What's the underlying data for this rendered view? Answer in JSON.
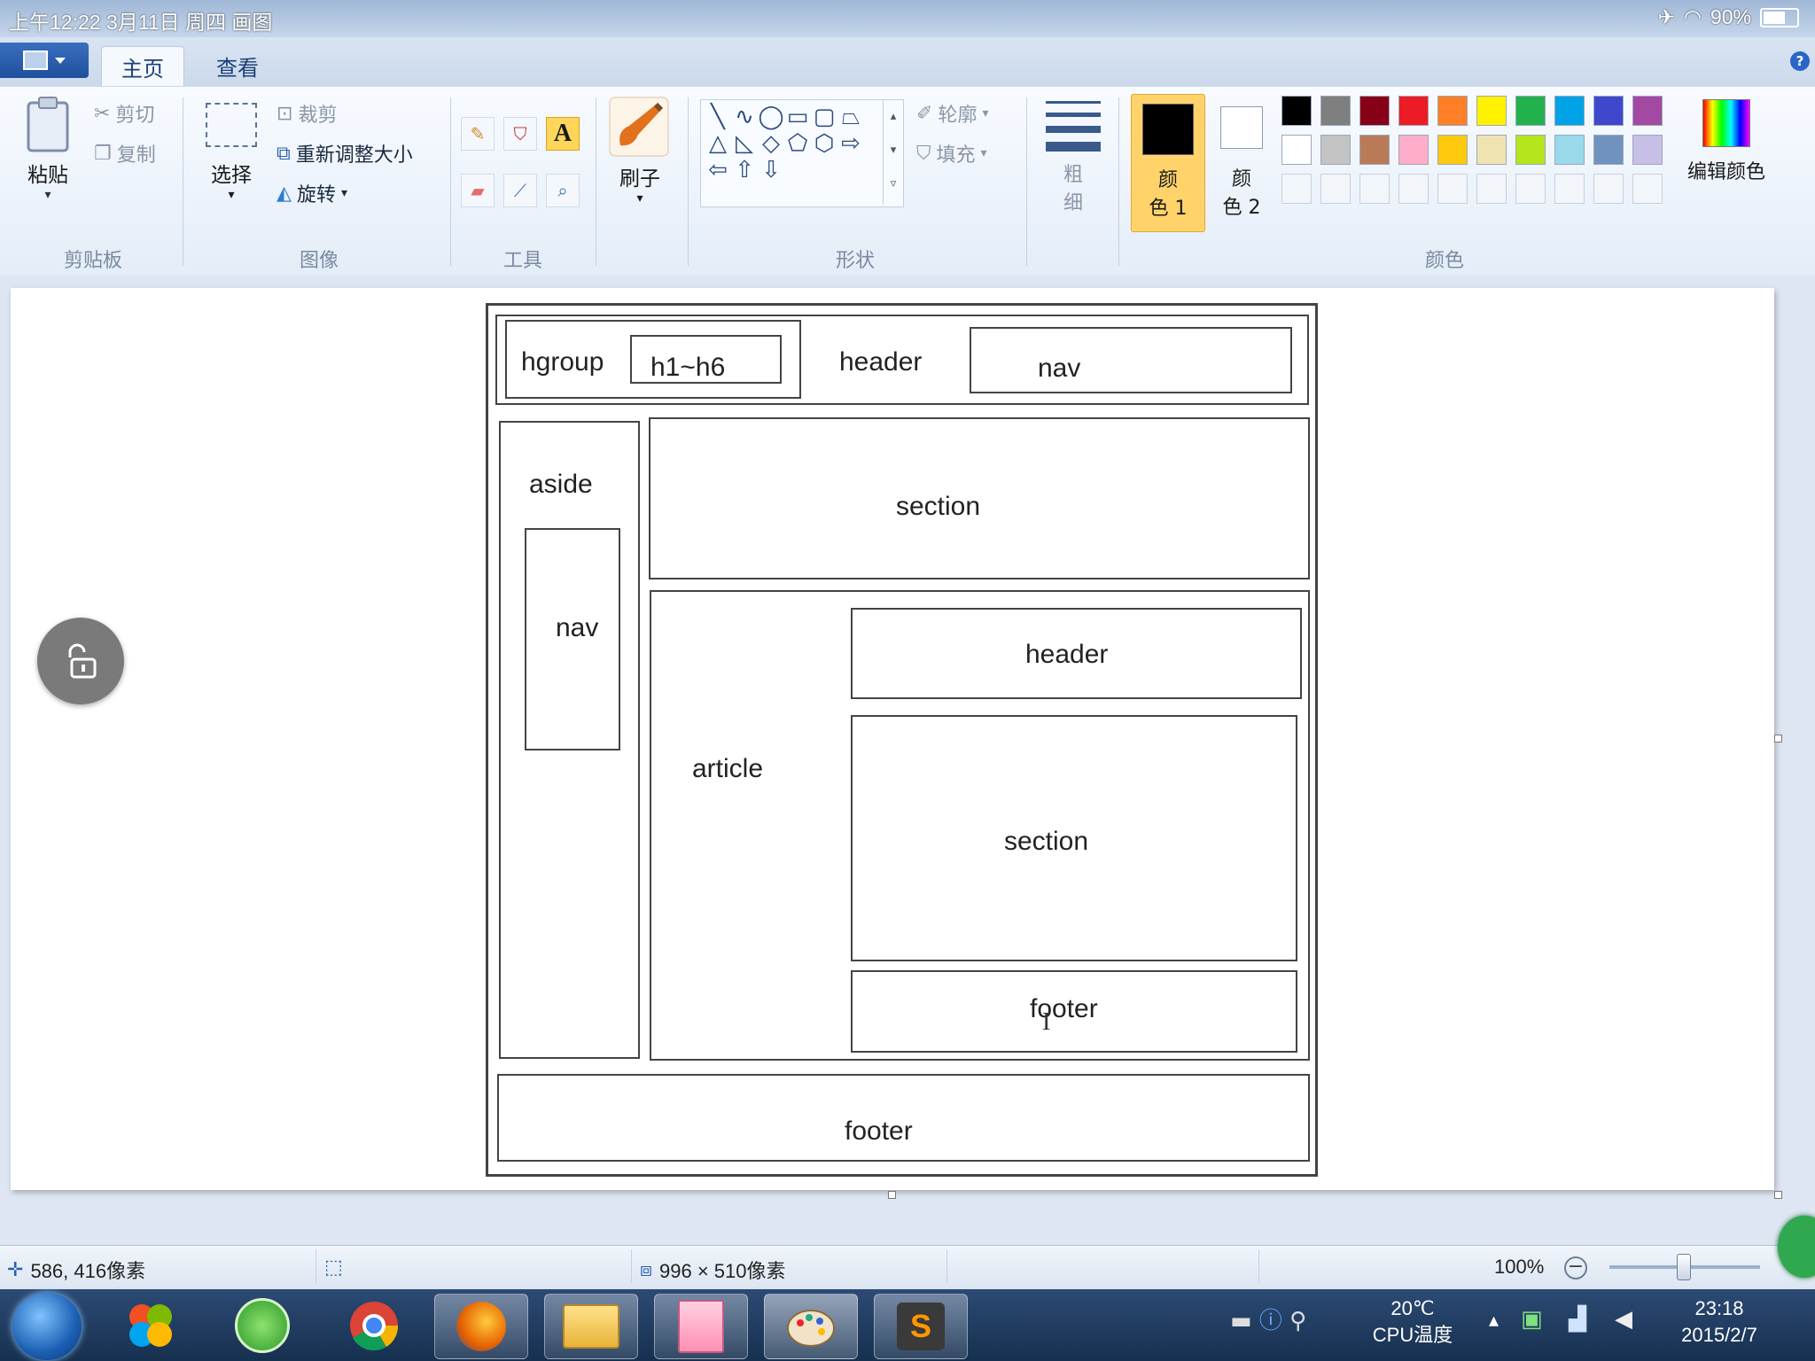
{
  "status_bar_top": {
    "left_text": "上午12:22  3月11日 周四 画图",
    "battery": "90%"
  },
  "ribbon": {
    "tabs": [
      "主页",
      "查看"
    ],
    "clipboard": {
      "paste": "粘贴",
      "cut": "剪切",
      "copy": "复制",
      "group": "剪贴板"
    },
    "image": {
      "select": "选择",
      "crop": "裁剪",
      "resize": "重新调整大小",
      "rotate": "旋转",
      "group": "图像"
    },
    "tools": {
      "group": "工具",
      "text_tool": "A"
    },
    "brushes": {
      "label": "刷子"
    },
    "shapes": {
      "outline": "轮廓",
      "fill": "填充",
      "group": "形状"
    },
    "size": {
      "label_line1": "粗",
      "label_line2": "细"
    },
    "colors": {
      "color1_line1": "颜",
      "color1_line2": "色 1",
      "color2_line1": "颜",
      "color2_line2": "色 2",
      "edit": "编辑颜色",
      "group": "颜色",
      "palette_row1": [
        "#000000",
        "#7f7f7f",
        "#880015",
        "#ed1c24",
        "#ff7f27",
        "#fff200",
        "#22b14c",
        "#00a2e8",
        "#3f48cc",
        "#a349a4"
      ],
      "palette_row2": [
        "#ffffff",
        "#c3c3c3",
        "#b97a57",
        "#ffaec9",
        "#ffc90e",
        "#efe4b0",
        "#b5e61d",
        "#99d9ea",
        "#7092be",
        "#c8bfe7"
      ]
    }
  },
  "drawing": {
    "hgroup": "hgroup",
    "h1h6": "h1~h6",
    "header_top": "header",
    "nav_top": "nav",
    "aside": "aside",
    "nav_aside": "nav",
    "section_top": "section",
    "article": "article",
    "article_header": "header",
    "article_section": "section",
    "article_footer": "footer",
    "footer_bottom": "footer"
  },
  "statusbar": {
    "cursor_pos": "586, 416像素",
    "canvas_size": "996 × 510像素",
    "zoom": "100%"
  },
  "taskbar": {
    "temp": "20℃",
    "cpu": "CPU温度",
    "time": "23:18",
    "date": "2015/2/7"
  }
}
